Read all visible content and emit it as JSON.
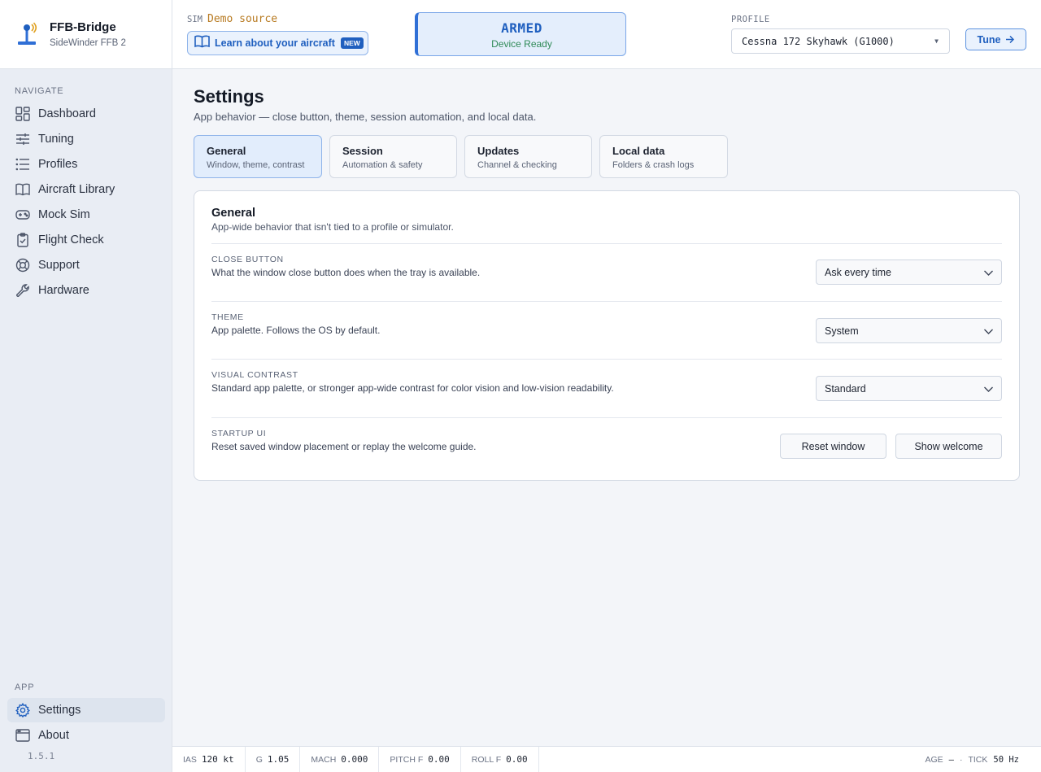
{
  "brand": {
    "name": "FFB-Bridge",
    "subtitle": "SideWinder FFB 2",
    "icon": "joystick-icon"
  },
  "sidebar": {
    "navigate_heading": "NAVIGATE",
    "items": [
      {
        "label": "Dashboard",
        "icon": "dashboard-icon"
      },
      {
        "label": "Tuning",
        "icon": "sliders-icon"
      },
      {
        "label": "Profiles",
        "icon": "list-icon"
      },
      {
        "label": "Aircraft Library",
        "icon": "book-icon"
      },
      {
        "label": "Mock Sim",
        "icon": "gamepad-icon"
      },
      {
        "label": "Flight Check",
        "icon": "clipboard-check-icon"
      },
      {
        "label": "Support",
        "icon": "lifebuoy-icon"
      },
      {
        "label": "Hardware",
        "icon": "wrench-icon"
      }
    ],
    "app_heading": "APP",
    "app_items": [
      {
        "label": "Settings",
        "icon": "gear-icon",
        "active": true
      },
      {
        "label": "About",
        "icon": "window-icon"
      }
    ],
    "version": "1.5.1"
  },
  "header": {
    "sim_label": "SIM",
    "sim_value": "Demo source",
    "learn_label": "Learn about your aircraft",
    "learn_badge": "NEW",
    "status_main": "ARMED",
    "status_sub": "Device Ready",
    "profile_label": "PROFILE",
    "profile_value": "Cessna 172 Skyhawk (G1000)",
    "tune_label": "Tune",
    "colors": {
      "accent": "#1f5fbf",
      "ok": "#2f8a57",
      "sim": "#b7791f"
    }
  },
  "page": {
    "title": "Settings",
    "description": "App behavior — close button, theme, session automation, and local data.",
    "tabs": [
      {
        "title": "General",
        "subtitle": "Window, theme, contrast",
        "active": true
      },
      {
        "title": "Session",
        "subtitle": "Automation & safety"
      },
      {
        "title": "Updates",
        "subtitle": "Channel & checking"
      },
      {
        "title": "Local data",
        "subtitle": "Folders & crash logs"
      }
    ]
  },
  "panel": {
    "title": "General",
    "subtitle": "App-wide behavior that isn't tied to a profile or simulator.",
    "rows": [
      {
        "label": "CLOSE BUTTON",
        "desc": "What the window close button does when the tray is available.",
        "value": "Ask every time"
      },
      {
        "label": "THEME",
        "desc": "App palette. Follows the OS by default.",
        "value": "System"
      },
      {
        "label": "VISUAL CONTRAST",
        "desc": "Standard app palette, or stronger app-wide contrast for color vision and low-vision readability.",
        "value": "Standard"
      },
      {
        "label": "STARTUP UI",
        "desc": "Reset saved window placement or replay the welcome guide.",
        "btn1": "Reset window",
        "btn2": "Show welcome"
      }
    ]
  },
  "statusbar": {
    "items": [
      {
        "label": "IAS",
        "value": "120 kt"
      },
      {
        "label": "G",
        "value": "1.05"
      },
      {
        "label": "MACH",
        "value": "0.000"
      },
      {
        "label": "PITCH F",
        "value": "0.00"
      },
      {
        "label": "ROLL F",
        "value": "0.00"
      }
    ],
    "age_label": "AGE",
    "age_value": "—",
    "sep": "·",
    "tick_label": "TICK",
    "tick_value": "50 Hz"
  }
}
